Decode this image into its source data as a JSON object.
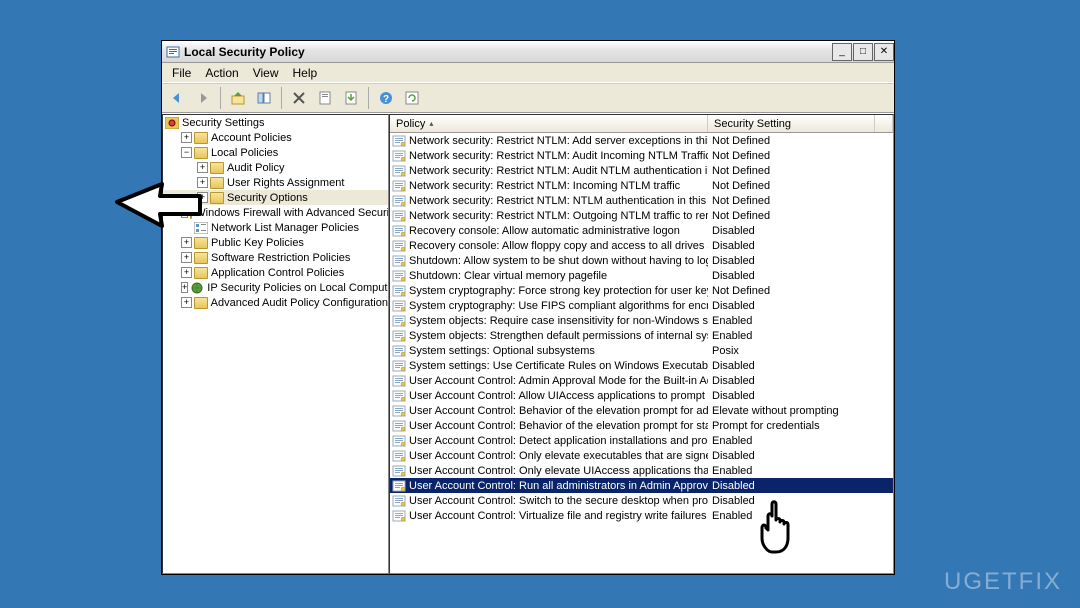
{
  "window": {
    "title": "Local Security Policy"
  },
  "menu": {
    "file": "File",
    "action": "Action",
    "view": "View",
    "help": "Help"
  },
  "tree": {
    "root": "Security Settings",
    "account_policies": "Account Policies",
    "local_policies": "Local Policies",
    "audit_policy": "Audit Policy",
    "user_rights": "User Rights Assignment",
    "security_options": "Security Options",
    "firewall": "Windows Firewall with Advanced Security",
    "network_list": "Network List Manager Policies",
    "public_key": "Public Key Policies",
    "software_restriction": "Software Restriction Policies",
    "app_control": "Application Control Policies",
    "ip_security": "IP Security Policies on Local Computer",
    "advanced_audit": "Advanced Audit Policy Configuration"
  },
  "columns": {
    "policy": "Policy",
    "setting": "Security Setting"
  },
  "policies": [
    {
      "name": "Network security: Restrict NTLM: Add server exceptions in this d...",
      "setting": "Not Defined"
    },
    {
      "name": "Network security: Restrict NTLM: Audit Incoming NTLM Traffic",
      "setting": "Not Defined"
    },
    {
      "name": "Network security: Restrict NTLM: Audit NTLM authentication in thi...",
      "setting": "Not Defined"
    },
    {
      "name": "Network security: Restrict NTLM: Incoming NTLM traffic",
      "setting": "Not Defined"
    },
    {
      "name": "Network security: Restrict NTLM: NTLM authentication in this dom...",
      "setting": "Not Defined"
    },
    {
      "name": "Network security: Restrict NTLM: Outgoing NTLM traffic to remot...",
      "setting": "Not Defined"
    },
    {
      "name": "Recovery console: Allow automatic administrative logon",
      "setting": "Disabled"
    },
    {
      "name": "Recovery console: Allow floppy copy and access to all drives and ...",
      "setting": "Disabled"
    },
    {
      "name": "Shutdown: Allow system to be shut down without having to log on",
      "setting": "Disabled"
    },
    {
      "name": "Shutdown: Clear virtual memory pagefile",
      "setting": "Disabled"
    },
    {
      "name": "System cryptography: Force strong key protection for user keys ...",
      "setting": "Not Defined"
    },
    {
      "name": "System cryptography: Use FIPS compliant algorithms for encrypti...",
      "setting": "Disabled"
    },
    {
      "name": "System objects: Require case insensitivity for non-Windows subs...",
      "setting": "Enabled"
    },
    {
      "name": "System objects: Strengthen default permissions of internal syste...",
      "setting": "Enabled"
    },
    {
      "name": "System settings: Optional subsystems",
      "setting": "Posix"
    },
    {
      "name": "System settings: Use Certificate Rules on Windows Executables f...",
      "setting": "Disabled"
    },
    {
      "name": "User Account Control: Admin Approval Mode for the Built-in Admi...",
      "setting": "Disabled"
    },
    {
      "name": "User Account Control: Allow UIAccess applications to prompt for ...",
      "setting": "Disabled"
    },
    {
      "name": "User Account Control: Behavior of the elevation prompt for admi...",
      "setting": "Elevate without prompting"
    },
    {
      "name": "User Account Control: Behavior of the elevation prompt for stand...",
      "setting": "Prompt for credentials"
    },
    {
      "name": "User Account Control: Detect application installations and prompt...",
      "setting": "Enabled"
    },
    {
      "name": "User Account Control: Only elevate executables that are signed ...",
      "setting": "Disabled"
    },
    {
      "name": "User Account Control: Only elevate UIAccess applications that ar...",
      "setting": "Enabled"
    },
    {
      "name": "User Account Control: Run all administrators in Admin Approval M...",
      "setting": "Disabled",
      "selected": true
    },
    {
      "name": "User Account Control: Switch to the secure desktop when prompt...",
      "setting": "Disabled"
    },
    {
      "name": "User Account Control: Virtualize file and registry write failures to ...",
      "setting": "Enabled"
    }
  ],
  "watermark": "UGETFIX"
}
